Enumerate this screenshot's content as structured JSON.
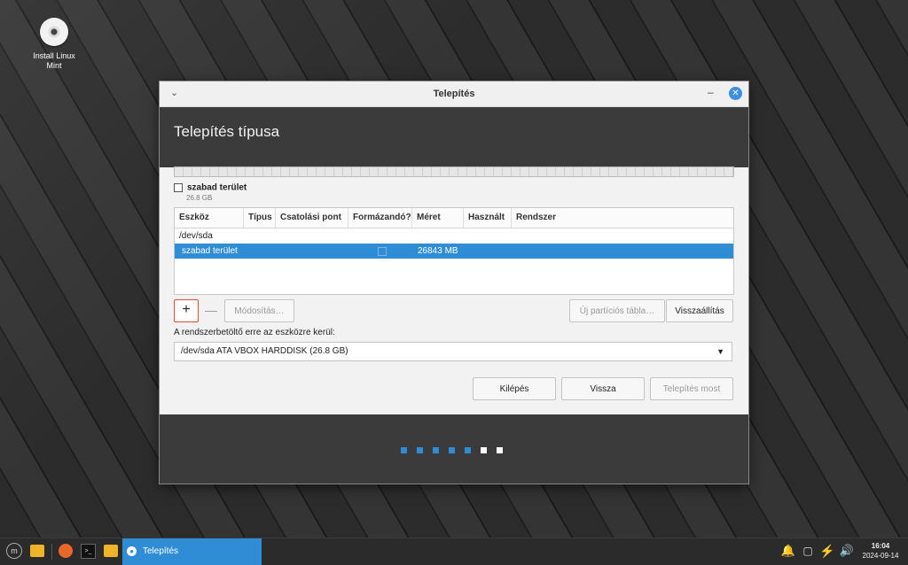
{
  "desktop": {
    "icon_label_line1": "Install Linux",
    "icon_label_line2": "Mint"
  },
  "window": {
    "title": "Telepítés",
    "header_title": "Telepítés típusa",
    "free_space_name": "szabad terület",
    "free_space_size": "26.8 GB",
    "table": {
      "columns": [
        "Eszköz",
        "Típus",
        "Csatolási pont",
        "Formázandó?",
        "Méret",
        "Használt",
        "Rendszer"
      ],
      "device_row": "/dev/sda",
      "selected_row": {
        "device": "szabad terület",
        "size": "26843 MB"
      }
    },
    "buttons": {
      "add": "+",
      "remove": "—",
      "change": "Módosítás…",
      "new_table": "Új partíciós tábla…",
      "revert": "Visszaállítás",
      "quit": "Kilépés",
      "back": "Vissza",
      "install_now": "Telepítés most"
    },
    "bootloader_label": "A rendszerbetöltő erre az eszközre kerül:",
    "bootloader_value": "/dev/sda ATA VBOX HARDDISK (26.8 GB)",
    "progress": {
      "total_steps": 7,
      "completed_steps": 5,
      "active_color": "#2f8dd6",
      "inactive_color": "#ffffff"
    }
  },
  "taskbar": {
    "task_label": "Telepítés",
    "time": "16:04",
    "date": "2024-09-14"
  }
}
